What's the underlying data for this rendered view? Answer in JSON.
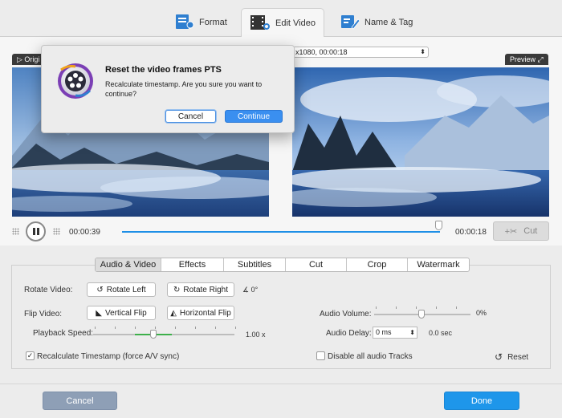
{
  "toolbar": {
    "tabs": [
      {
        "label": "Format",
        "icon": "format-icon"
      },
      {
        "label": "Edit Video",
        "icon": "film-scissors-icon"
      },
      {
        "label": "Name & Tag",
        "icon": "tag-pencil-icon"
      }
    ],
    "active_tab": "Edit Video",
    "accent": "#1e8fe6"
  },
  "video": {
    "original_label": "Origi",
    "preview_label": "Preview",
    "resolution_value": "x1080, 00:00:18",
    "current_time": "00:00:39",
    "end_time": "00:00:18",
    "cut_label": "Cut"
  },
  "edit": {
    "tabs": [
      "Audio & Video",
      "Effects",
      "Subtitles",
      "Cut",
      "Crop",
      "Watermark"
    ],
    "active_tab": "Audio & Video",
    "rotate_label": "Rotate Video:",
    "rotate_left": "Rotate Left",
    "rotate_right": "Rotate Right",
    "rotate_angle": "0°",
    "flip_label": "Flip Video:",
    "flip_vertical": "Vertical Flip",
    "flip_horizontal": "Horizontal Flip",
    "speed_label": "Playback Speed:",
    "speed_value": "1.00",
    "speed_unit": "x",
    "recalc_label": "Recalculate Timestamp (force A/V sync)",
    "recalc_checked": true,
    "volume_label": "Audio Volume:",
    "volume_value": "0%",
    "delay_label": "Audio Delay:",
    "delay_input": "0 ms",
    "delay_readout": "0.0 sec",
    "disable_audio_label": "Disable all audio Tracks",
    "disable_audio_checked": false,
    "reset_label": "Reset"
  },
  "footer": {
    "cancel_label": "Cancel",
    "done_label": "Done"
  },
  "dialog": {
    "title": "Reset the video frames PTS",
    "message": "Recalculate timestamp. Are you sure you want to continue?",
    "cancel_label": "Cancel",
    "continue_label": "Continue"
  }
}
